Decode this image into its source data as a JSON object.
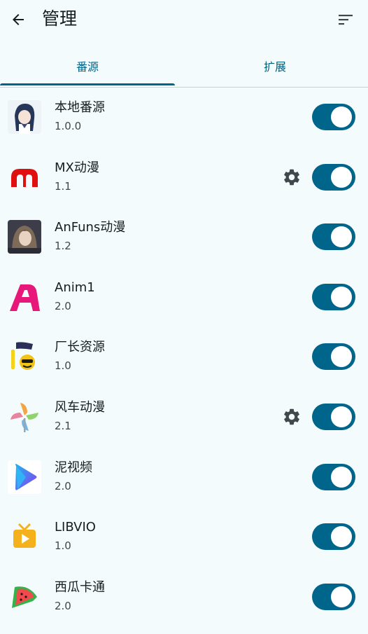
{
  "app_bar": {
    "title": "管理",
    "back_icon": "arrow-back-icon",
    "sort_icon": "sort-icon"
  },
  "tabs": [
    {
      "label": "番源",
      "selected": true
    },
    {
      "label": "扩展",
      "selected": false
    }
  ],
  "colors": {
    "accent": "#00658b",
    "background": "#f4fbfd"
  },
  "sources": [
    {
      "name": "本地番源",
      "version": "1.0.0",
      "enabled": true,
      "has_settings": false,
      "icon": "anime-girl-avatar-icon"
    },
    {
      "name": "MX动漫",
      "version": "1.1",
      "enabled": true,
      "has_settings": true,
      "icon": "mx-logo-icon"
    },
    {
      "name": "AnFuns动漫",
      "version": "1.2",
      "enabled": true,
      "has_settings": false,
      "icon": "anfuns-avatar-icon"
    },
    {
      "name": "Anim1",
      "version": "2.0",
      "enabled": true,
      "has_settings": false,
      "icon": "anim1-logo-icon"
    },
    {
      "name": "厂长资源",
      "version": "1.0",
      "enabled": true,
      "has_settings": false,
      "icon": "czzy-logo-icon"
    },
    {
      "name": "风车动漫",
      "version": "2.1",
      "enabled": true,
      "has_settings": true,
      "icon": "pinwheel-icon"
    },
    {
      "name": "泥视频",
      "version": "2.0",
      "enabled": true,
      "has_settings": false,
      "icon": "play-triangle-icon"
    },
    {
      "name": "LIBVIO",
      "version": "1.0",
      "enabled": true,
      "has_settings": false,
      "icon": "tv-play-icon"
    },
    {
      "name": "西瓜卡通",
      "version": "2.0",
      "enabled": true,
      "has_settings": false,
      "icon": "watermelon-icon"
    }
  ]
}
